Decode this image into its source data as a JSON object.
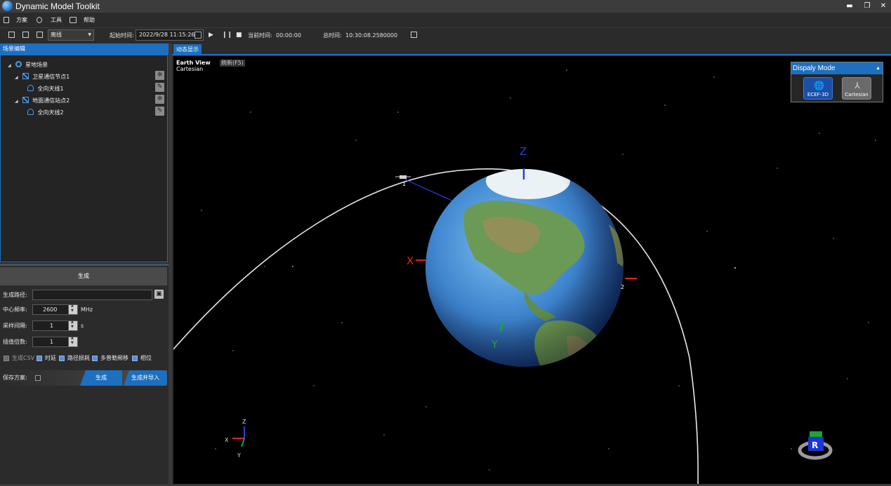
{
  "window": {
    "title": "Dynamic Model Toolkit"
  },
  "menu": [
    {
      "label": "方案"
    },
    {
      "label": "工具"
    },
    {
      "label": "帮助"
    }
  ],
  "toolbar": {
    "mode": "离线",
    "start_label": "起始时间:",
    "start_value": "2022/9/28 11:15:26",
    "current_label": "当前时间:",
    "current_value": "00:00:00",
    "total_label": "总时间:",
    "total_value": "10:30:08.2580000"
  },
  "left_panel": {
    "title": "场景编辑",
    "tree": [
      {
        "label": "星地场景",
        "level": 0
      },
      {
        "label": "卫星通信节点1",
        "level": 1
      },
      {
        "label": "全向天线1",
        "level": 2
      },
      {
        "label": "地面通信站点2",
        "level": 1
      },
      {
        "label": "全向天线2",
        "level": 2
      }
    ],
    "generate_header": "生成",
    "path_label": "生成路径:",
    "path_value": "",
    "freq_label": "中心频率:",
    "freq_value": "2600",
    "freq_unit": "MHz",
    "interval_label": "采样间隔:",
    "interval_value": "1",
    "interval_unit": "s",
    "interp_label": "插值倍数:",
    "interp_value": "1",
    "options": [
      {
        "label": "生成CSV",
        "checked": true,
        "disabled": true
      },
      {
        "label": "时延",
        "checked": true
      },
      {
        "label": "路径损耗",
        "checked": true
      },
      {
        "label": "多普勒频移",
        "checked": true
      },
      {
        "label": "相位",
        "checked": true
      }
    ],
    "save_label": "保存方案:",
    "save_checked": false,
    "gen_button": "生成",
    "gen_import_button": "生成并导入"
  },
  "view": {
    "tab": "动态显示",
    "view_title": "Earth View",
    "view_sub": "Cartesian",
    "refresh": "刷新(F5)",
    "display_mode": {
      "title": "Dispaly Mode",
      "buttons": [
        {
          "label": "ECEF-3D",
          "active": true
        },
        {
          "label": "Cartesian",
          "active": false
        }
      ]
    },
    "axes": {
      "x": "X",
      "y": "Y",
      "z": "Z"
    },
    "markers": [
      "1",
      "2"
    ],
    "nav_cube": "R"
  },
  "colors": {
    "accent": "#1d6fbf",
    "x_axis": "#e02020",
    "y_axis": "#1fa23a",
    "z_axis": "#2a3de0"
  }
}
